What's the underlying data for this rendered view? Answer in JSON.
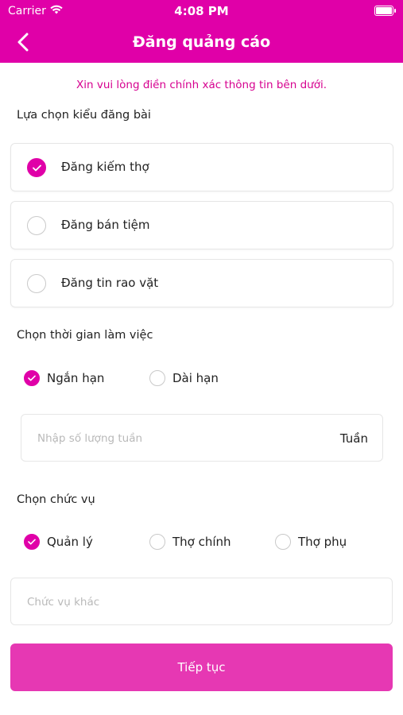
{
  "status_bar": {
    "carrier": "Carrier",
    "time": "4:08 PM"
  },
  "header": {
    "title": "Đăng quảng cáo"
  },
  "notice": "Xin vui lòng điền chính xác thông tin bên dưới.",
  "post_type": {
    "label": "Lựa chọn kiểu đăng bài",
    "options": [
      {
        "label": "Đăng kiếm thợ",
        "selected": true
      },
      {
        "label": "Đăng bán tiệm",
        "selected": false
      },
      {
        "label": "Đăng tin rao vặt",
        "selected": false
      }
    ]
  },
  "work_time": {
    "label": "Chọn thời gian làm việc",
    "options": [
      {
        "label": "Ngắn hạn",
        "selected": true
      },
      {
        "label": "Dài hạn",
        "selected": false
      }
    ],
    "weeks_input": {
      "placeholder": "Nhập số lượng tuần",
      "value": "",
      "unit": "Tuần"
    }
  },
  "position": {
    "label": "Chọn chức vụ",
    "options": [
      {
        "label": "Quản lý",
        "selected": true
      },
      {
        "label": "Thợ chính",
        "selected": false
      },
      {
        "label": "Thợ phụ",
        "selected": false
      }
    ],
    "other_input": {
      "placeholder": "Chức vụ khác",
      "value": ""
    }
  },
  "submit_label": "Tiếp tục",
  "colors": {
    "primary": "#e000a8",
    "button": "#e638b3",
    "notice": "#d6008f"
  }
}
